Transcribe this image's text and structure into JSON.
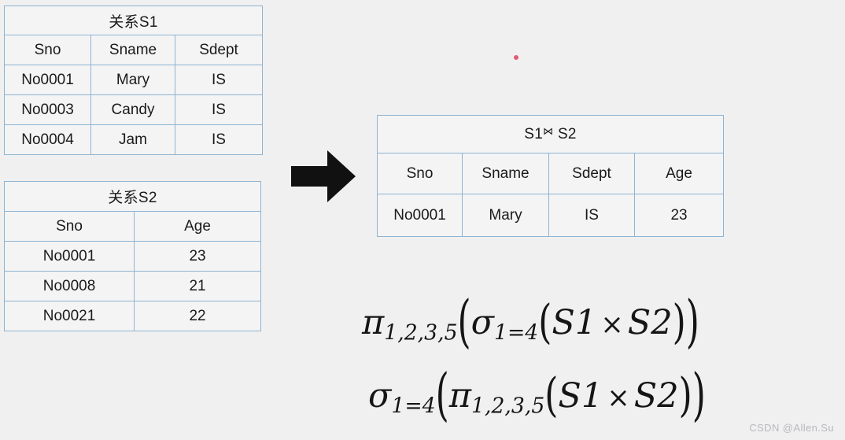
{
  "background_color": "#f0f0f1",
  "border_color": "#8fb3d0",
  "cell_color": "#f4f4f5",
  "tables": {
    "s1": {
      "title": "关系S1",
      "columns": [
        "Sno",
        "Sname",
        "Sdept"
      ],
      "rows": [
        [
          "No0001",
          "Mary",
          "IS"
        ],
        [
          "No0003",
          "Candy",
          "IS"
        ],
        [
          "No0004",
          "Jam",
          "IS"
        ]
      ]
    },
    "s2": {
      "title": "关系S2",
      "columns": [
        "Sno",
        "Age"
      ],
      "rows": [
        [
          "No0001",
          "23"
        ],
        [
          "No0008",
          "21"
        ],
        [
          "No0021",
          "22"
        ]
      ]
    },
    "result": {
      "title_left": "S1",
      "title_symbol": "⋈",
      "title_right": " S2",
      "columns": [
        "Sno",
        "Sname",
        "Sdept",
        "Age"
      ],
      "rows": [
        [
          "No0001",
          "Mary",
          "IS",
          "23"
        ]
      ]
    }
  },
  "arrow": {
    "icon": "right-arrow-icon",
    "color": "#111111"
  },
  "pointer": {
    "icon": "cursor-dot-icon",
    "color": "#e0415c"
  },
  "formulas": {
    "first": {
      "op1": "π",
      "op1_sub": "1,2,3,5",
      "open1": "(",
      "op2": "σ",
      "op2_sub": "1=4",
      "open2": "(",
      "left_rel": "S1",
      "times": "×",
      "right_rel": "S2",
      "close2": ")",
      "close1": ")"
    },
    "second": {
      "op1": "σ",
      "op1_sub": "1=4",
      "open1": "(",
      "op2": "π",
      "op2_sub": "1,2,3,5",
      "open2": "(",
      "left_rel": "S1",
      "times": "×",
      "right_rel": "S2",
      "close2": ")",
      "close1": ")"
    }
  },
  "watermark": "CSDN @Allen.Su"
}
